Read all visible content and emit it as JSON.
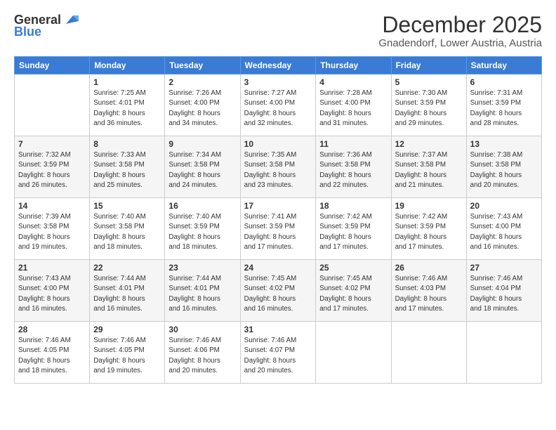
{
  "logo": {
    "general": "General",
    "blue": "Blue"
  },
  "header": {
    "month": "December 2025",
    "location": "Gnadendorf, Lower Austria, Austria"
  },
  "days_of_week": [
    "Sunday",
    "Monday",
    "Tuesday",
    "Wednesday",
    "Thursday",
    "Friday",
    "Saturday"
  ],
  "weeks": [
    [
      {
        "day": "",
        "info": ""
      },
      {
        "day": "1",
        "info": "Sunrise: 7:25 AM\nSunset: 4:01 PM\nDaylight: 8 hours\nand 36 minutes."
      },
      {
        "day": "2",
        "info": "Sunrise: 7:26 AM\nSunset: 4:00 PM\nDaylight: 8 hours\nand 34 minutes."
      },
      {
        "day": "3",
        "info": "Sunrise: 7:27 AM\nSunset: 4:00 PM\nDaylight: 8 hours\nand 32 minutes."
      },
      {
        "day": "4",
        "info": "Sunrise: 7:28 AM\nSunset: 4:00 PM\nDaylight: 8 hours\nand 31 minutes."
      },
      {
        "day": "5",
        "info": "Sunrise: 7:30 AM\nSunset: 3:59 PM\nDaylight: 8 hours\nand 29 minutes."
      },
      {
        "day": "6",
        "info": "Sunrise: 7:31 AM\nSunset: 3:59 PM\nDaylight: 8 hours\nand 28 minutes."
      }
    ],
    [
      {
        "day": "7",
        "info": "Sunrise: 7:32 AM\nSunset: 3:59 PM\nDaylight: 8 hours\nand 26 minutes."
      },
      {
        "day": "8",
        "info": "Sunrise: 7:33 AM\nSunset: 3:58 PM\nDaylight: 8 hours\nand 25 minutes."
      },
      {
        "day": "9",
        "info": "Sunrise: 7:34 AM\nSunset: 3:58 PM\nDaylight: 8 hours\nand 24 minutes."
      },
      {
        "day": "10",
        "info": "Sunrise: 7:35 AM\nSunset: 3:58 PM\nDaylight: 8 hours\nand 23 minutes."
      },
      {
        "day": "11",
        "info": "Sunrise: 7:36 AM\nSunset: 3:58 PM\nDaylight: 8 hours\nand 22 minutes."
      },
      {
        "day": "12",
        "info": "Sunrise: 7:37 AM\nSunset: 3:58 PM\nDaylight: 8 hours\nand 21 minutes."
      },
      {
        "day": "13",
        "info": "Sunrise: 7:38 AM\nSunset: 3:58 PM\nDaylight: 8 hours\nand 20 minutes."
      }
    ],
    [
      {
        "day": "14",
        "info": "Sunrise: 7:39 AM\nSunset: 3:58 PM\nDaylight: 8 hours\nand 19 minutes."
      },
      {
        "day": "15",
        "info": "Sunrise: 7:40 AM\nSunset: 3:58 PM\nDaylight: 8 hours\nand 18 minutes."
      },
      {
        "day": "16",
        "info": "Sunrise: 7:40 AM\nSunset: 3:59 PM\nDaylight: 8 hours\nand 18 minutes."
      },
      {
        "day": "17",
        "info": "Sunrise: 7:41 AM\nSunset: 3:59 PM\nDaylight: 8 hours\nand 17 minutes."
      },
      {
        "day": "18",
        "info": "Sunrise: 7:42 AM\nSunset: 3:59 PM\nDaylight: 8 hours\nand 17 minutes."
      },
      {
        "day": "19",
        "info": "Sunrise: 7:42 AM\nSunset: 3:59 PM\nDaylight: 8 hours\nand 17 minutes."
      },
      {
        "day": "20",
        "info": "Sunrise: 7:43 AM\nSunset: 4:00 PM\nDaylight: 8 hours\nand 16 minutes."
      }
    ],
    [
      {
        "day": "21",
        "info": "Sunrise: 7:43 AM\nSunset: 4:00 PM\nDaylight: 8 hours\nand 16 minutes."
      },
      {
        "day": "22",
        "info": "Sunrise: 7:44 AM\nSunset: 4:01 PM\nDaylight: 8 hours\nand 16 minutes."
      },
      {
        "day": "23",
        "info": "Sunrise: 7:44 AM\nSunset: 4:01 PM\nDaylight: 8 hours\nand 16 minutes."
      },
      {
        "day": "24",
        "info": "Sunrise: 7:45 AM\nSunset: 4:02 PM\nDaylight: 8 hours\nand 16 minutes."
      },
      {
        "day": "25",
        "info": "Sunrise: 7:45 AM\nSunset: 4:02 PM\nDaylight: 8 hours\nand 17 minutes."
      },
      {
        "day": "26",
        "info": "Sunrise: 7:46 AM\nSunset: 4:03 PM\nDaylight: 8 hours\nand 17 minutes."
      },
      {
        "day": "27",
        "info": "Sunrise: 7:46 AM\nSunset: 4:04 PM\nDaylight: 8 hours\nand 18 minutes."
      }
    ],
    [
      {
        "day": "28",
        "info": "Sunrise: 7:46 AM\nSunset: 4:05 PM\nDaylight: 8 hours\nand 18 minutes."
      },
      {
        "day": "29",
        "info": "Sunrise: 7:46 AM\nSunset: 4:05 PM\nDaylight: 8 hours\nand 19 minutes."
      },
      {
        "day": "30",
        "info": "Sunrise: 7:46 AM\nSunset: 4:06 PM\nDaylight: 8 hours\nand 20 minutes."
      },
      {
        "day": "31",
        "info": "Sunrise: 7:46 AM\nSunset: 4:07 PM\nDaylight: 8 hours\nand 20 minutes."
      },
      {
        "day": "",
        "info": ""
      },
      {
        "day": "",
        "info": ""
      },
      {
        "day": "",
        "info": ""
      }
    ]
  ]
}
